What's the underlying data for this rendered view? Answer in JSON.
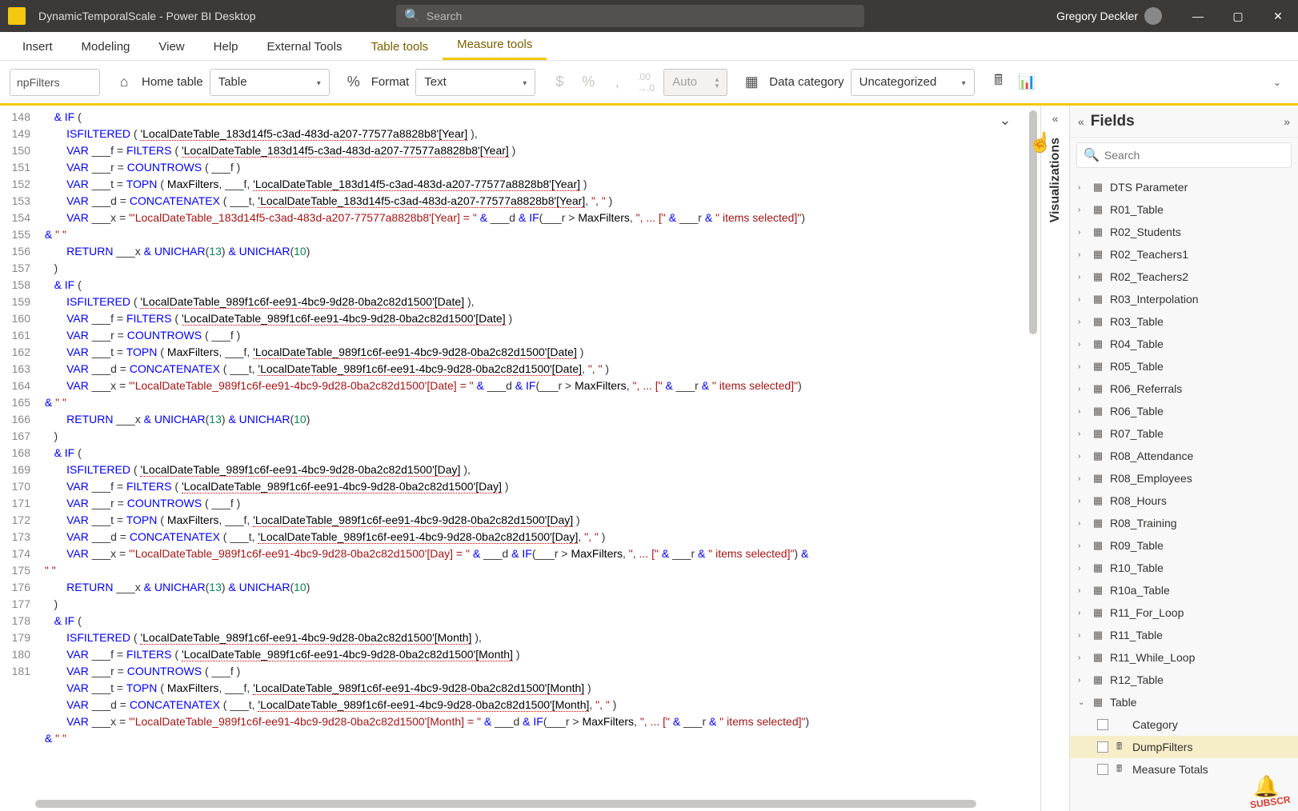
{
  "title": "DynamicTemporalScale - Power BI Desktop",
  "search_placeholder": "Search",
  "user_name": "Gregory Deckler",
  "menu": {
    "insert": "Insert",
    "modeling": "Modeling",
    "view": "View",
    "help": "Help",
    "external": "External Tools",
    "table_tools": "Table tools",
    "measure_tools": "Measure tools"
  },
  "ribbon": {
    "name_value": "npFilters",
    "home_table": "Home table",
    "home_table_value": "Table",
    "format": "Format",
    "format_value": "Text",
    "auto_value": "Auto",
    "data_category": "Data category",
    "data_category_value": "Uncategorized"
  },
  "gutter_lines": [
    "148",
    "149",
    "150",
    "151",
    "152",
    "153",
    "154",
    "",
    "155",
    "156",
    "157",
    "158",
    "159",
    "160",
    "161",
    "162",
    "163",
    "",
    "164",
    "165",
    "166",
    "167",
    "168",
    "169",
    "170",
    "171",
    "172",
    "",
    "",
    "173",
    "",
    "174",
    "175",
    "176",
    "177",
    "178",
    "179",
    "180",
    "181"
  ],
  "code": {
    "l148": "    & IF (",
    "l149_a": "        ISFILTERED ( ",
    "l149_ref": "'LocalDateTable_183d14f5-c3ad-483d-a207-77577a8828b8'[Year]",
    "l149_b": " ),",
    "l150_a": "        VAR ___f = FILTERS ( ",
    "l150_ref": "'LocalDateTable_183d14f5-c3ad-483d-a207-77577a8828b8'[Year]",
    "l150_b": " )",
    "l151": "        VAR ___r = COUNTROWS ( ___f )",
    "l152_a": "        VAR ___t = TOPN ( MaxFilters, ___f, ",
    "l152_ref": "'LocalDateTable_183d14f5-c3ad-483d-a207-77577a8828b8'[Year]",
    "l152_b": " )",
    "l153_a": "        VAR ___d = CONCATENATEX ( ___t, ",
    "l153_ref": "'LocalDateTable_183d14f5-c3ad-483d-a207-77577a8828b8'[Year]",
    "l153_b": ", \", \" )",
    "l154": "        VAR ___x = \"'LocalDateTable_183d14f5-c3ad-483d-a207-77577a8828b8'[Year] = \" & ___d & IF(___r > MaxFilters, \", ... [\" & ___r & \" items selected]\")",
    "l154b": " & \" \"",
    "l155": "        RETURN ___x & UNICHAR(13) & UNICHAR(10)",
    "l156": "    )",
    "l157": "    & IF (",
    "l158_a": "        ISFILTERED ( ",
    "l158_ref": "'LocalDateTable_989f1c6f-ee91-4bc9-9d28-0ba2c82d1500'[Date]",
    "l158_b": " ),",
    "l159_a": "        VAR ___f = FILTERS ( ",
    "l159_ref": "'LocalDateTable_989f1c6f-ee91-4bc9-9d28-0ba2c82d1500'[Date]",
    "l159_b": " )",
    "l160": "        VAR ___r = COUNTROWS ( ___f )",
    "l161_a": "        VAR ___t = TOPN ( MaxFilters, ___f, ",
    "l161_ref": "'LocalDateTable_989f1c6f-ee91-4bc9-9d28-0ba2c82d1500'[Date]",
    "l161_b": " )",
    "l162_a": "        VAR ___d = CONCATENATEX ( ___t, ",
    "l162_ref": "'LocalDateTable_989f1c6f-ee91-4bc9-9d28-0ba2c82d1500'[Date]",
    "l162_b": ", \", \" )",
    "l163": "        VAR ___x = \"'LocalDateTable_989f1c6f-ee91-4bc9-9d28-0ba2c82d1500'[Date] = \" & ___d & IF(___r > MaxFilters, \", ... [\" & ___r & \" items selected]\")",
    "l163b": " & \" \"",
    "l164": "        RETURN ___x & UNICHAR(13) & UNICHAR(10)",
    "l165": "    )",
    "l166": "    & IF (",
    "l167_a": "        ISFILTERED ( ",
    "l167_ref": "'LocalDateTable_989f1c6f-ee91-4bc9-9d28-0ba2c82d1500'[Day]",
    "l167_b": " ),",
    "l168_a": "        VAR ___f = FILTERS ( ",
    "l168_ref": "'LocalDateTable_989f1c6f-ee91-4bc9-9d28-0ba2c82d1500'[Day]",
    "l168_b": " )",
    "l169": "        VAR ___r = COUNTROWS ( ___f )",
    "l170_a": "        VAR ___t = TOPN ( MaxFilters, ___f, ",
    "l170_ref": "'LocalDateTable_989f1c6f-ee91-4bc9-9d28-0ba2c82d1500'[Day]",
    "l170_b": " )",
    "l171_a": "        VAR ___d = CONCATENATEX ( ___t, ",
    "l171_ref": "'LocalDateTable_989f1c6f-ee91-4bc9-9d28-0ba2c82d1500'[Day]",
    "l171_b": ", \", \" )",
    "l172": "        VAR ___x = \"'LocalDateTable_989f1c6f-ee91-4bc9-9d28-0ba2c82d1500'[Day] = \" & ___d & IF(___r > MaxFilters, \", ... [\" & ___r & \" items selected]\") &",
    "l172b": " \" \"",
    "l173": "        RETURN ___x & UNICHAR(13) & UNICHAR(10)",
    "l173b": "    )",
    "l174": "    & IF (",
    "l175_a": "        ISFILTERED ( ",
    "l175_ref": "'LocalDateTable_989f1c6f-ee91-4bc9-9d28-0ba2c82d1500'[Month]",
    "l175_b": " ),",
    "l176_a": "        VAR ___f = FILTERS ( ",
    "l176_ref": "'LocalDateTable_989f1c6f-ee91-4bc9-9d28-0ba2c82d1500'[Month]",
    "l176_b": " )",
    "l177": "        VAR ___r = COUNTROWS ( ___f )",
    "l178_a": "        VAR ___t = TOPN ( MaxFilters, ___f, ",
    "l178_ref": "'LocalDateTable_989f1c6f-ee91-4bc9-9d28-0ba2c82d1500'[Month]",
    "l178_b": " )",
    "l179_a": "        VAR ___d = CONCATENATEX ( ___t, ",
    "l179_ref": "'LocalDateTable_989f1c6f-ee91-4bc9-9d28-0ba2c82d1500'[Month]",
    "l179_b": ", \", \" )",
    "l180": "        VAR ___x = \"'LocalDateTable_989f1c6f-ee91-4bc9-9d28-0ba2c82d1500'[Month] = \" & ___d & IF(___r > MaxFilters, \", ... [\" & ___r & \" items selected]\")",
    "l180b": " & \" \""
  },
  "viz_label": "Visualizations",
  "fields": {
    "title": "Fields",
    "search_placeholder": "Search",
    "items": [
      {
        "name": "DTS Parameter",
        "icon": "table"
      },
      {
        "name": "R01_Table",
        "icon": "table"
      },
      {
        "name": "R02_Students",
        "icon": "table"
      },
      {
        "name": "R02_Teachers1",
        "icon": "table"
      },
      {
        "name": "R02_Teachers2",
        "icon": "table"
      },
      {
        "name": "R03_Interpolation",
        "icon": "table"
      },
      {
        "name": "R03_Table",
        "icon": "table"
      },
      {
        "name": "R04_Table",
        "icon": "table"
      },
      {
        "name": "R05_Table",
        "icon": "table"
      },
      {
        "name": "R06_Referrals",
        "icon": "table"
      },
      {
        "name": "R06_Table",
        "icon": "table"
      },
      {
        "name": "R07_Table",
        "icon": "table"
      },
      {
        "name": "R08_Attendance",
        "icon": "table"
      },
      {
        "name": "R08_Employees",
        "icon": "table"
      },
      {
        "name": "R08_Hours",
        "icon": "table"
      },
      {
        "name": "R08_Training",
        "icon": "table"
      },
      {
        "name": "R09_Table",
        "icon": "table"
      },
      {
        "name": "R10_Table",
        "icon": "table"
      },
      {
        "name": "R10a_Table",
        "icon": "table"
      },
      {
        "name": "R11_For_Loop",
        "icon": "table"
      },
      {
        "name": "R11_Table",
        "icon": "table"
      },
      {
        "name": "R11_While_Loop",
        "icon": "table"
      },
      {
        "name": "R12_Table",
        "icon": "table"
      }
    ],
    "expanded_table": "Table",
    "children": [
      {
        "name": "Category",
        "checked": false,
        "selected": false,
        "type": "field"
      },
      {
        "name": "DumpFilters",
        "checked": false,
        "selected": true,
        "type": "measure"
      },
      {
        "name": "Measure Totals",
        "checked": false,
        "selected": false,
        "type": "measure"
      }
    ]
  },
  "subscribe": "SUBSCR"
}
